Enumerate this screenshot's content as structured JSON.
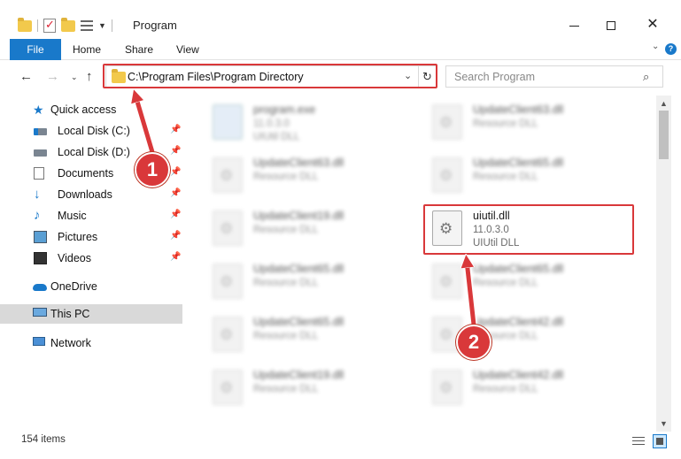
{
  "window": {
    "title": "Program",
    "controls": {
      "minimize": "",
      "maximize": "",
      "close": "✕"
    }
  },
  "ribbon": {
    "tabs": [
      "File",
      "Home",
      "Share",
      "View"
    ]
  },
  "nav": {
    "address": "C:\\Program Files\\Program Directory",
    "search_placeholder": "Search Program"
  },
  "sidebar": {
    "items": [
      {
        "label": "Quick access",
        "icon": "star-icon"
      },
      {
        "label": "Local Disk (C:)",
        "icon": "disk-icon",
        "pinned": true
      },
      {
        "label": "Local Disk (D:)",
        "icon": "disk-icon",
        "pinned": true
      },
      {
        "label": "Documents",
        "icon": "documents-icon",
        "pinned": true
      },
      {
        "label": "Downloads",
        "icon": "downloads-icon",
        "pinned": true
      },
      {
        "label": "Music",
        "icon": "music-icon",
        "pinned": true
      },
      {
        "label": "Pictures",
        "icon": "pictures-icon",
        "pinned": true
      },
      {
        "label": "Videos",
        "icon": "videos-icon",
        "pinned": true
      },
      {
        "label": "OneDrive",
        "icon": "cloud-icon"
      },
      {
        "label": "This PC",
        "icon": "computer-icon",
        "selected": true
      },
      {
        "label": "Network",
        "icon": "network-icon"
      }
    ]
  },
  "files": [
    {
      "name": "program.exe",
      "line2": "11.0.3.0",
      "line3": "UIUtil DLL",
      "blurred": true
    },
    {
      "name": "UpdateClient63.dll",
      "line2": "Resource DLL",
      "blurred": true
    },
    {
      "name": "UpdateClient63.dll",
      "line2": "Resource DLL",
      "blurred": true
    },
    {
      "name": "UpdateClient65.dll",
      "line2": "Resource DLL",
      "blurred": true
    },
    {
      "name": "UpdateClient19.dll",
      "line2": "Resource DLL",
      "blurred": true
    },
    {
      "name": "uiutil.dll",
      "line2": "11.0.3.0",
      "line3": "UIUtil DLL",
      "blurred": false
    },
    {
      "name": "UpdateClient65.dll",
      "line2": "Resource DLL",
      "blurred": true
    },
    {
      "name": "UpdateClient65.dll",
      "line2": "Resource DLL",
      "blurred": true
    },
    {
      "name": "UpdateClient65.dll",
      "line2": "Resource DLL",
      "blurred": true
    },
    {
      "name": "UpdateClient42.dll",
      "line2": "Resource DLL",
      "blurred": true
    },
    {
      "name": "UpdateClient19.dll",
      "line2": "Resource DLL",
      "blurred": true
    },
    {
      "name": "UpdateClient42.dll",
      "line2": "Resource DLL",
      "blurred": true
    }
  ],
  "status": {
    "item_count": "154 items"
  },
  "annotations": {
    "step1": "1",
    "step2": "2",
    "color": "#d9383a"
  }
}
